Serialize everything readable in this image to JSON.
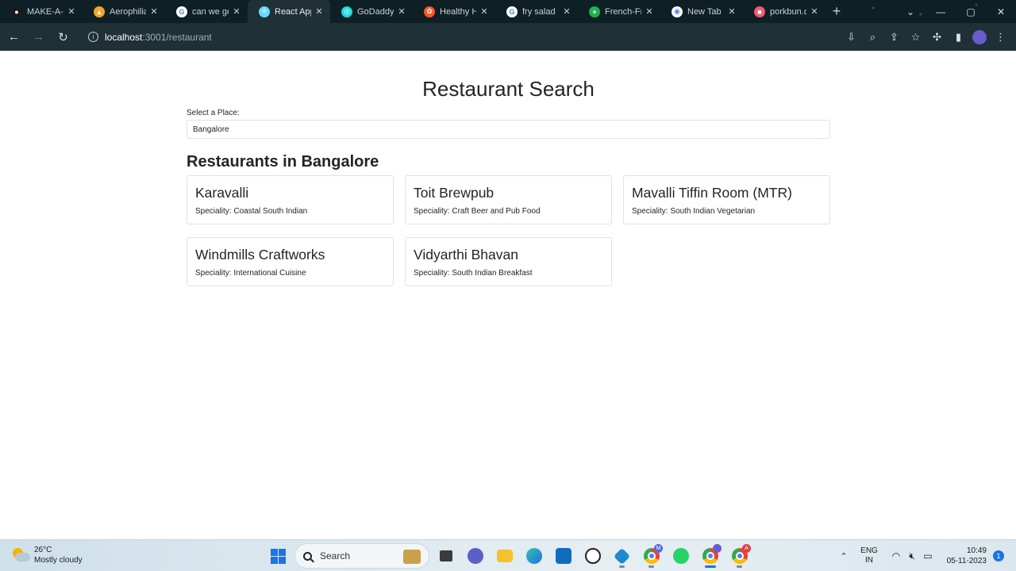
{
  "browser": {
    "tabs": [
      {
        "title": "MAKE-A-TI",
        "fav_color": "#1a1a1a",
        "fav_glyph": "●"
      },
      {
        "title": "Aerophilia",
        "fav_color": "#f5a623",
        "fav_glyph": "▲"
      },
      {
        "title": "can we ge",
        "fav_color": "#ffffff",
        "fav_glyph": "G"
      },
      {
        "title": "React App",
        "fav_color": "#61dafb",
        "fav_glyph": "⚛"
      },
      {
        "title": "GoDaddy",
        "fav_color": "#1bdbdb",
        "fav_glyph": "◎"
      },
      {
        "title": "Healthy H",
        "fav_color": "#ff5722",
        "fav_glyph": "✿"
      },
      {
        "title": "fry salad",
        "fav_color": "#ffffff",
        "fav_glyph": "G"
      },
      {
        "title": "French-Fr",
        "fav_color": "#1eb34f",
        "fav_glyph": "+"
      },
      {
        "title": "New Tab",
        "fav_color": "#ffffff",
        "fav_glyph": "◉"
      },
      {
        "title": "porkbun.c",
        "fav_color": "#ef5b6f",
        "fav_glyph": "■"
      }
    ],
    "active_tab_index": 3,
    "close_glyph": "✕",
    "newtab_glyph": "+",
    "address": {
      "host": "localhost",
      "path": ":3001/restaurant"
    }
  },
  "page": {
    "title": "Restaurant Search",
    "select_label": "Select a Place:",
    "selected_place": "Bangalore",
    "section_title": "Restaurants in Bangalore",
    "restaurants": [
      {
        "name": "Karavalli",
        "speciality": "Speciality: Coastal South Indian"
      },
      {
        "name": "Toit Brewpub",
        "speciality": "Speciality: Craft Beer and Pub Food"
      },
      {
        "name": "Mavalli Tiffin Room (MTR)",
        "speciality": "Speciality: South Indian Vegetarian"
      },
      {
        "name": "Windmills Craftworks",
        "speciality": "Speciality: International Cuisine"
      },
      {
        "name": "Vidyarthi Bhavan",
        "speciality": "Speciality: South Indian Breakfast"
      }
    ]
  },
  "taskbar": {
    "weather": {
      "temp": "26°C",
      "condition": "Mostly cloudy"
    },
    "search_placeholder": "Search",
    "lang": {
      "line1": "ENG",
      "line2": "IN"
    },
    "clock": {
      "time": "10:49",
      "date": "05-11-2023"
    },
    "notification_count": "1",
    "badges": {
      "chrome_profile_1": "M",
      "chrome_profile_2": "A"
    },
    "colors": {
      "accent": "#1a73e8"
    }
  }
}
